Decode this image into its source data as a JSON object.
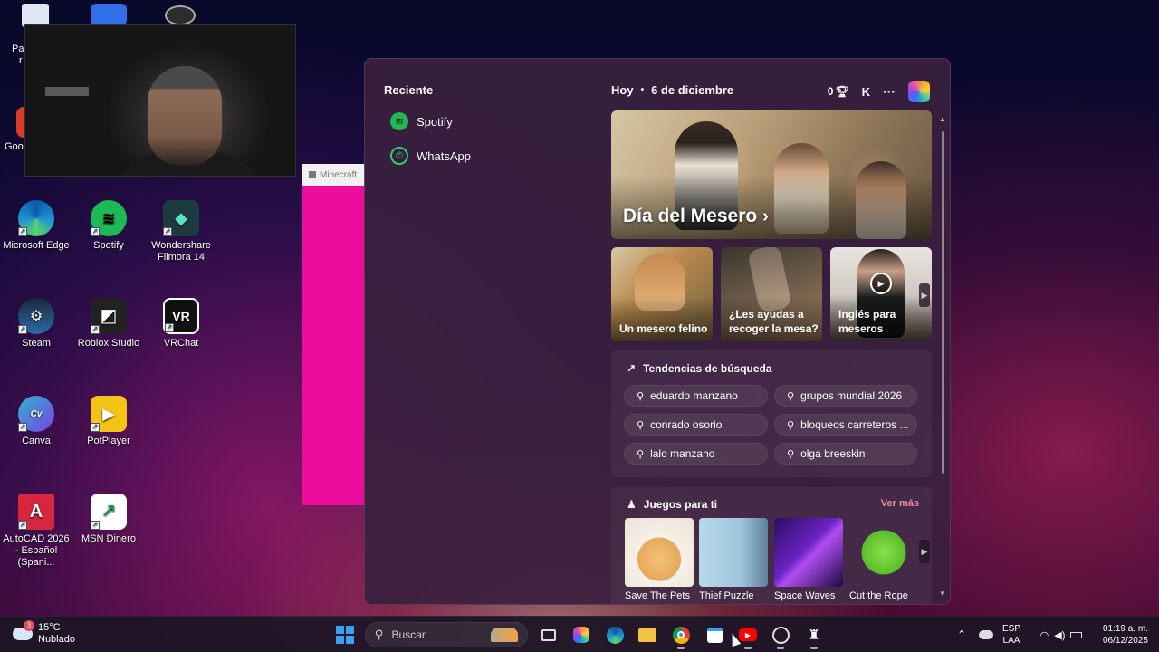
{
  "desktop": {
    "icons": [
      {
        "label": "Microsoft Edge",
        "icon": "edge-icon",
        "color": "#1f8fd6"
      },
      {
        "label": "Spotify",
        "icon": "spotify-icon",
        "color": "#1db954"
      },
      {
        "label": "Wondershare Filmora 14",
        "icon": "filmora-icon",
        "color": "#1d3b3f"
      },
      {
        "label": "Steam",
        "icon": "steam-icon",
        "color": "#1b2838"
      },
      {
        "label": "Roblox Studio",
        "icon": "roblox-studio-icon",
        "color": "#222"
      },
      {
        "label": "VRChat",
        "icon": "vrchat-icon",
        "color": "#111"
      },
      {
        "label": "Canva",
        "icon": "canva-icon",
        "color": "#2fb5d2"
      },
      {
        "label": "PotPlayer",
        "icon": "potplayer-icon",
        "color": "#f3c316"
      },
      {
        "label": "AutoCAD 2026 - Español (Spani...",
        "icon": "autocad-icon",
        "color": "#d7263d"
      },
      {
        "label": "MSN Dinero",
        "icon": "msn-dinero-icon",
        "color": "#ffffff"
      }
    ],
    "partial_labels": {
      "pap": "Pap",
      "r": "r",
      "goog": "Goog"
    }
  },
  "minecraft_window": {
    "title": "Minecraft"
  },
  "widget_panel": {
    "recent": {
      "title": "Reciente",
      "items": [
        {
          "label": "Spotify",
          "icon": "spotify-icon"
        },
        {
          "label": "WhatsApp",
          "icon": "whatsapp-icon"
        }
      ]
    },
    "header": {
      "today": "Hoy",
      "date": "6 de diciembre",
      "rewards_count": "0",
      "profile_initial": "K",
      "more": "···"
    },
    "hero": {
      "title": "Día del Mesero",
      "arrow": "›"
    },
    "cards": [
      {
        "label": "Un mesero felino",
        "video": false
      },
      {
        "label": "¿Les ayudas a recoger la mesa?",
        "video": false
      },
      {
        "label": "Inglés para meseros",
        "video": true
      }
    ],
    "trends": {
      "title": "Tendencias de búsqueda",
      "items": [
        "eduardo manzano",
        "grupos mundial 2026",
        "conrado osorio",
        "bloqueos carreteros ...",
        "lalo manzano",
        "olga breeskin"
      ]
    },
    "games": {
      "title": "Juegos para ti",
      "see_more": "Ver más",
      "items": [
        {
          "name": "Save The Pets"
        },
        {
          "name": "Thief Puzzle"
        },
        {
          "name": "Space Waves"
        },
        {
          "name": "Cut the Rope"
        }
      ]
    }
  },
  "taskbar": {
    "weather": {
      "temp": "15°C",
      "condition": "Nublado",
      "badge": "3"
    },
    "search_placeholder": "Buscar",
    "apps": [
      "start-icon",
      "search-highlight-icon",
      "task-view-icon",
      "copilot-icon",
      "edge-icon",
      "file-explorer-icon",
      "chrome-icon",
      "store-icon",
      "youtube-icon",
      "obs-icon",
      "castle-app-icon"
    ],
    "tray": {
      "lang_top": "ESP",
      "lang_bottom": "LAA",
      "time": "01:19 a. m.",
      "date": "06/12/2025"
    }
  },
  "colors": {
    "accent_pink": "#f08aa8",
    "panel_bg": "#3a203e",
    "spotify_green": "#1db954",
    "whatsapp_green": "#25d366"
  }
}
